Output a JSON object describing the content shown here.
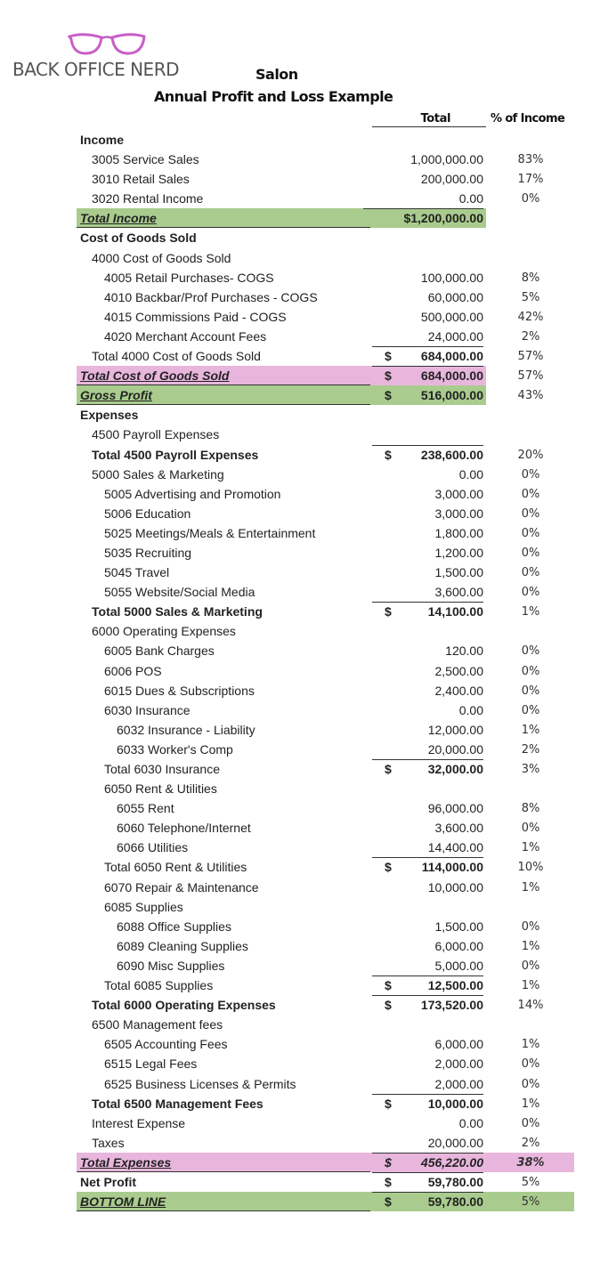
{
  "brand": {
    "logo_icon": "cat-eye-glasses-icon",
    "name": "BACK OFFICE NERD",
    "accent_color": "#c956c9"
  },
  "report": {
    "title": "Salon",
    "subtitle": "Annual Profit and Loss Example",
    "columns": {
      "total": "Total",
      "pct": "% of Income"
    }
  },
  "colors": {
    "green_highlight": "#a9cc8e",
    "pink_highlight": "#e8b6dd"
  },
  "rows": [
    {
      "label": "Income",
      "amount": "",
      "pct": ""
    },
    {
      "label": "3005 Service Sales",
      "amount": "1,000,000.00",
      "pct": "83%"
    },
    {
      "label": "3010 Retail Sales",
      "amount": "200,000.00",
      "pct": "17%"
    },
    {
      "label": "3020 Rental Income",
      "amount": "0.00",
      "pct": "0%"
    },
    {
      "label": "Total Income",
      "amount": "$1,200,000.00",
      "pct": ""
    },
    {
      "label": "Cost of Goods Sold",
      "amount": "",
      "pct": ""
    },
    {
      "label": "4000 Cost of Goods Sold",
      "amount": "",
      "pct": ""
    },
    {
      "label": "4005 Retail Purchases- COGS",
      "amount": "100,000.00",
      "pct": "8%"
    },
    {
      "label": "4010 Backbar/Prof Purchases - COGS",
      "amount": "60,000.00",
      "pct": "5%"
    },
    {
      "label": "4015 Commissions Paid - COGS",
      "amount": "500,000.00",
      "pct": "42%"
    },
    {
      "label": "4020 Merchant Account Fees",
      "amount": "24,000.00",
      "pct": "2%"
    },
    {
      "label": "Total 4000 Cost of Goods Sold",
      "dollar": "$",
      "amount": "684,000.00",
      "pct": "57%"
    },
    {
      "label": "Total Cost of Goods Sold",
      "dollar": "$",
      "amount": "684,000.00",
      "pct": "57%"
    },
    {
      "label": "Gross Profit",
      "dollar": "$",
      "amount": "516,000.00",
      "pct": "43%"
    },
    {
      "label": "Expenses",
      "amount": "",
      "pct": ""
    },
    {
      "label": "4500 Payroll Expenses",
      "amount": "",
      "pct": ""
    },
    {
      "label": "Total 4500 Payroll Expenses",
      "dollar": "$",
      "amount": "238,600.00",
      "pct": "20%"
    },
    {
      "label": "5000 Sales & Marketing",
      "amount": "0.00",
      "pct": "0%"
    },
    {
      "label": "5005 Advertising and Promotion",
      "amount": "3,000.00",
      "pct": "0%"
    },
    {
      "label": "5006 Education",
      "amount": "3,000.00",
      "pct": "0%"
    },
    {
      "label": "5025 Meetings/Meals & Entertainment",
      "amount": "1,800.00",
      "pct": "0%"
    },
    {
      "label": "5035 Recruiting",
      "amount": "1,200.00",
      "pct": "0%"
    },
    {
      "label": "5045 Travel",
      "amount": "1,500.00",
      "pct": "0%"
    },
    {
      "label": "5055 Website/Social Media",
      "amount": "3,600.00",
      "pct": "0%"
    },
    {
      "label": "Total 5000 Sales & Marketing",
      "dollar": "$",
      "amount": "14,100.00",
      "pct": "1%"
    },
    {
      "label": "6000 Operating Expenses",
      "amount": "",
      "pct": ""
    },
    {
      "label": "6005 Bank Charges",
      "amount": "120.00",
      "pct": "0%"
    },
    {
      "label": "6006 POS",
      "amount": "2,500.00",
      "pct": "0%"
    },
    {
      "label": "6015 Dues & Subscriptions",
      "amount": "2,400.00",
      "pct": "0%"
    },
    {
      "label": "6030 Insurance",
      "amount": "0.00",
      "pct": "0%"
    },
    {
      "label": "6032 Insurance - Liability",
      "amount": "12,000.00",
      "pct": "1%"
    },
    {
      "label": "6033 Worker's Comp",
      "amount": "20,000.00",
      "pct": "2%"
    },
    {
      "label": "Total 6030 Insurance",
      "dollar": "$",
      "amount": "32,000.00",
      "pct": "3%"
    },
    {
      "label": "6050 Rent & Utilities",
      "amount": "",
      "pct": ""
    },
    {
      "label": "6055 Rent",
      "amount": "96,000.00",
      "pct": "8%"
    },
    {
      "label": "6060 Telephone/Internet",
      "amount": "3,600.00",
      "pct": "0%"
    },
    {
      "label": "6066 Utilities",
      "amount": "14,400.00",
      "pct": "1%"
    },
    {
      "label": "Total 6050 Rent & Utilities",
      "dollar": "$",
      "amount": "114,000.00",
      "pct": "10%"
    },
    {
      "label": "6070 Repair & Maintenance",
      "amount": "10,000.00",
      "pct": "1%"
    },
    {
      "label": "6085 Supplies",
      "amount": "",
      "pct": ""
    },
    {
      "label": "6088 Office Supplies",
      "amount": "1,500.00",
      "pct": "0%"
    },
    {
      "label": "6089 Cleaning Supplies",
      "amount": "6,000.00",
      "pct": "1%"
    },
    {
      "label": "6090 Misc Supplies",
      "amount": "5,000.00",
      "pct": "0%"
    },
    {
      "label": "Total 6085 Supplies",
      "dollar": "$",
      "amount": "12,500.00",
      "pct": "1%"
    },
    {
      "label": "Total 6000 Operating Expenses",
      "dollar": "$",
      "amount": "173,520.00",
      "pct": "14%"
    },
    {
      "label": "6500 Management fees",
      "amount": "",
      "pct": ""
    },
    {
      "label": "6505 Accounting Fees",
      "amount": "6,000.00",
      "pct": "1%"
    },
    {
      "label": "6515 Legal Fees",
      "amount": "2,000.00",
      "pct": "0%"
    },
    {
      "label": "6525  Business Licenses & Permits",
      "amount": "2,000.00",
      "pct": "0%"
    },
    {
      "label": "Total 6500 Management Fees",
      "dollar": "$",
      "amount": "10,000.00",
      "pct": "1%"
    },
    {
      "label": "Interest Expense",
      "amount": "0.00",
      "pct": "0%"
    },
    {
      "label": "Taxes",
      "amount": "20,000.00",
      "pct": "2%"
    },
    {
      "label": "Total Expenses",
      "dollar": "$",
      "amount": "456,220.00",
      "pct": "38%"
    },
    {
      "label": "Net Profit",
      "dollar": "$",
      "amount": "59,780.00",
      "pct": "5%"
    },
    {
      "label": "BOTTOM LINE",
      "dollar": "$",
      "amount": "59,780.00",
      "pct": "5%"
    }
  ]
}
